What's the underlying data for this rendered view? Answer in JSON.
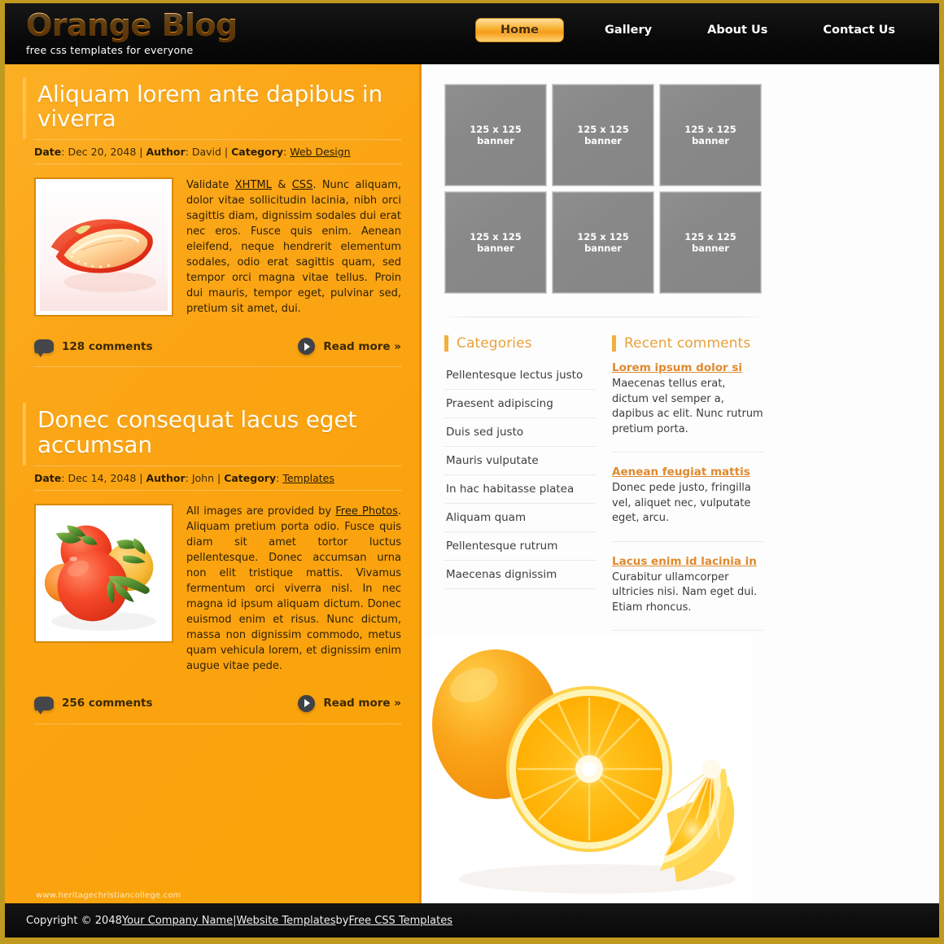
{
  "header": {
    "brand_title": "Orange Blog",
    "brand_tagline": "free css templates for everyone",
    "nav": [
      {
        "label": "Home",
        "active": true
      },
      {
        "label": "Gallery",
        "active": false
      },
      {
        "label": "About Us",
        "active": false
      },
      {
        "label": "Contact Us",
        "active": false
      }
    ]
  },
  "posts": [
    {
      "title": "Aliquam lorem ante dapibus in viverra",
      "meta": {
        "date_label": "Date",
        "date_value": "Dec 20, 2048",
        "author_label": "Author",
        "author_value": "David",
        "category_label": "Category",
        "category_value": "Web Design"
      },
      "image_alt": "sliced-strawberry",
      "body_lead": "Validate ",
      "link1": "XHTML",
      "body_mid": " & ",
      "link2": "CSS",
      "body_rest": ". Nunc aliquam, dolor vitae sollicitudin lacinia, nibh orci sagittis diam, dignissim sodales dui erat nec eros. Fusce quis enim. Aenean eleifend, neque hendrerit elementum sodales, odio erat sagittis quam, sed tempor orci magna vitae tellus. Proin dui mauris, tempor eget, pulvinar sed, pretium sit amet, dui.",
      "comments_label": "128 comments",
      "read_more_label": "Read more »"
    },
    {
      "title": "Donec consequat lacus eget accumsan",
      "meta": {
        "date_label": "Date",
        "date_value": "Dec 14, 2048",
        "author_label": "Author",
        "author_value": "John",
        "category_label": "Category",
        "category_value": "Templates"
      },
      "image_alt": "tomatoes-on-the-vine",
      "body_lead": "All images are provided by ",
      "link1": "Free Photos",
      "body_mid": "",
      "link2": "",
      "body_rest": ". Aliquam pretium porta odio. Fusce quis diam sit amet tortor luctus pellentesque. Donec accumsan urna non elit tristique mattis. Vivamus fermentum orci viverra nisl. In nec magna id ipsum aliquam dictum. Donec euismod enim et risus. Nunc dictum, massa non dignissim commodo, metus quam vehicula lorem, et dignissim enim augue vitae pede.",
      "comments_label": "256 comments",
      "read_more_label": "Read more »"
    }
  ],
  "banners": [
    {
      "size": "125 x 125",
      "caption": "banner"
    },
    {
      "size": "125 x 125",
      "caption": "banner"
    },
    {
      "size": "125 x 125",
      "caption": "banner"
    },
    {
      "size": "125 x 125",
      "caption": "banner"
    },
    {
      "size": "125 x 125",
      "caption": "banner"
    },
    {
      "size": "125 x 125",
      "caption": "banner"
    }
  ],
  "categories": {
    "title": "Categories",
    "items": [
      "Pellentesque lectus justo",
      "Praesent adipiscing",
      "Duis sed justo",
      "Mauris vulputate",
      "In hac habitasse platea",
      "Aliquam quam",
      "Pellentesque rutrum",
      "Maecenas dignissim"
    ]
  },
  "recent_comments": {
    "title": "Recent comments",
    "items": [
      {
        "link": "Lorem ipsum dolor si",
        "text": "Maecenas tellus erat, dictum vel semper a, dapibus ac elit. Nunc rutrum pretium porta."
      },
      {
        "link": "Aenean feugiat mattis",
        "text": "Donec pede justo, fringilla vel, aliquet nec, vulputate eget, arcu."
      },
      {
        "link": "Lacus enim id lacinia in",
        "text": "Curabitur ullamcorper ultricies nisi. Nam eget dui. Etiam rhoncus."
      }
    ]
  },
  "photo": {
    "alt": "oranges-whole-half-and-wedge"
  },
  "watermark": "www.heritagechristiancollege.com",
  "footer": {
    "copyright_prefix": "Copyright © 2048 ",
    "company_link": "Your Company Name",
    "sep": " | ",
    "templates_link": "Website Templates",
    "by": " by ",
    "credit_link": "Free CSS Templates"
  },
  "colors": {
    "accent_orange": "#f9a409",
    "dark_header": "#0c0c0c",
    "widget_title": "#e9a13a",
    "link_orange": "#e08a2e",
    "banner_gray": "#888888",
    "page_border": "#bf9a1f"
  }
}
